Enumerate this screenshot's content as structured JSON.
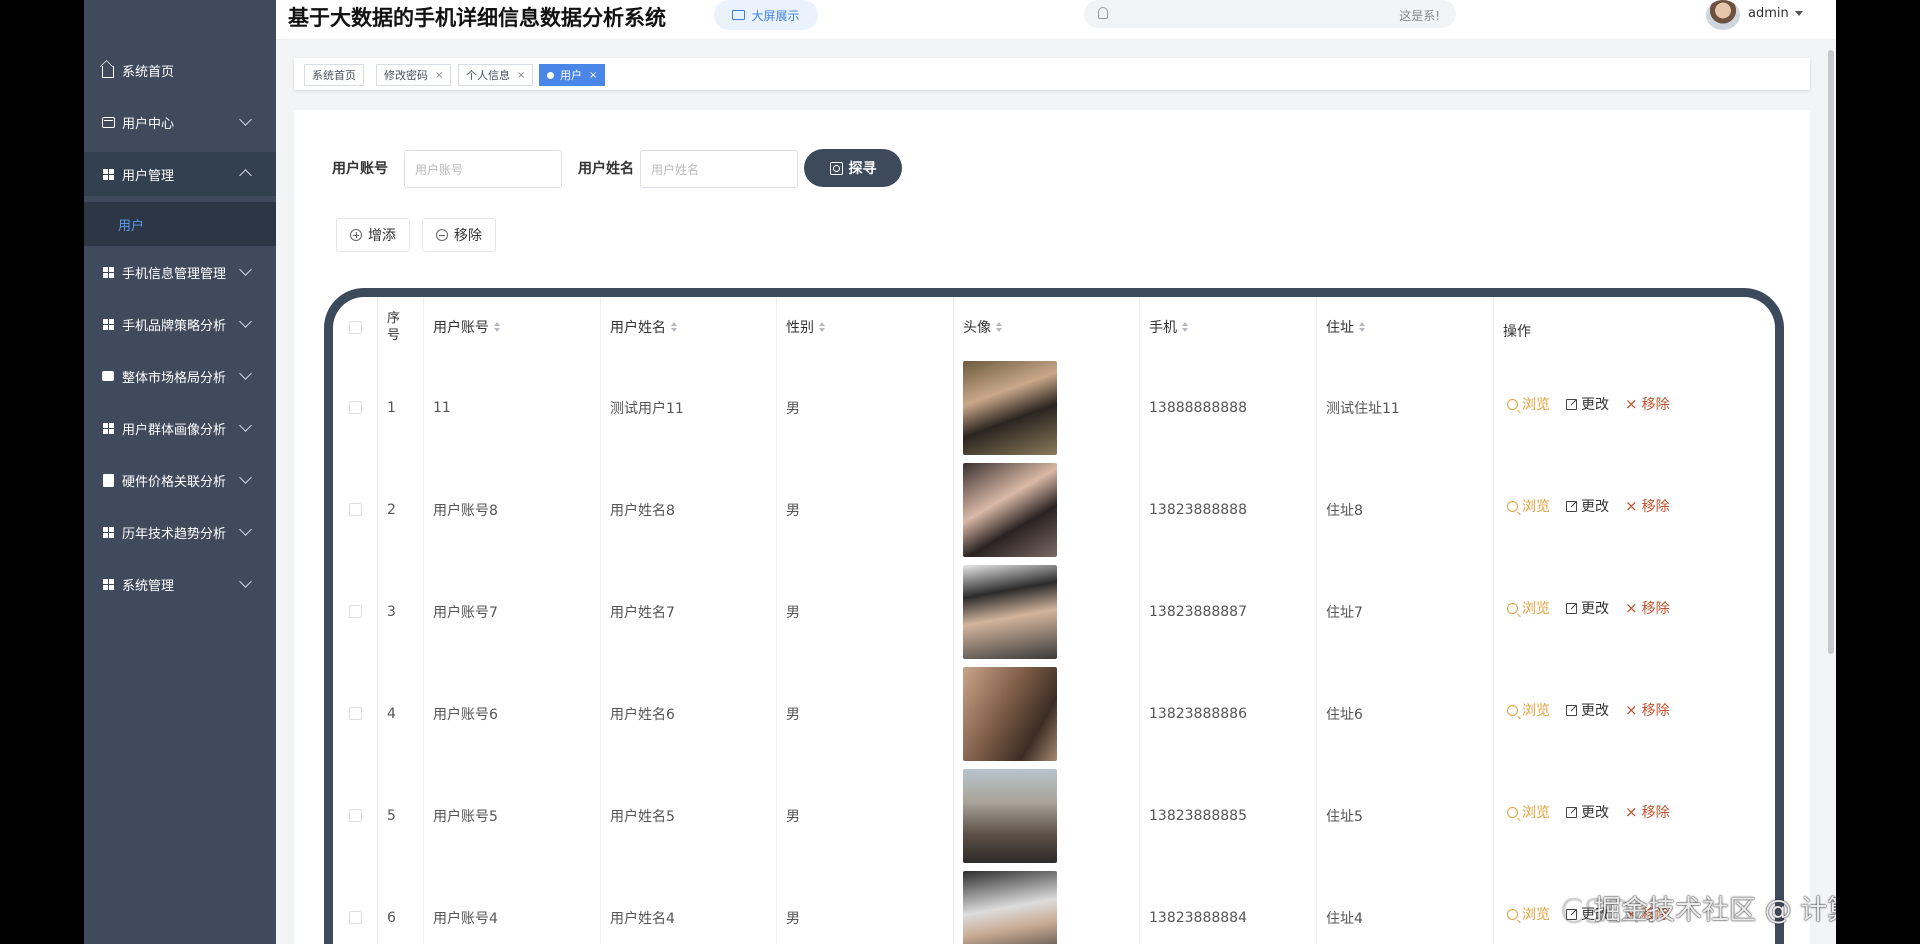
{
  "header": {
    "title": "基于大数据的手机详细信息数据分析系统",
    "big_screen_label": "大屏展示",
    "notice_text": "这是系!",
    "user_name": "admin"
  },
  "sidebar": {
    "items": [
      {
        "label": "系统首页",
        "icon": "home-icon"
      },
      {
        "label": "用户中心",
        "icon": "card-icon"
      },
      {
        "label": "用户管理",
        "icon": "grid-icon"
      },
      {
        "label": "手机信息管理管理",
        "icon": "grid-icon"
      },
      {
        "label": "手机品牌策略分析",
        "icon": "grid-icon"
      },
      {
        "label": "整体市场格局分析",
        "icon": "chat-icon"
      },
      {
        "label": "用户群体画像分析",
        "icon": "grid-icon"
      },
      {
        "label": "硬件价格关联分析",
        "icon": "clipboard-icon"
      },
      {
        "label": "历年技术趋势分析",
        "icon": "grid-icon"
      },
      {
        "label": "系统管理",
        "icon": "grid-icon"
      }
    ],
    "active_sub": "用户"
  },
  "tags": [
    {
      "label": "系统首页"
    },
    {
      "label": "修改密码"
    },
    {
      "label": "个人信息"
    },
    {
      "label": "用户"
    }
  ],
  "search": {
    "account_label": "用户账号",
    "account_placeholder": "用户账号",
    "name_label": "用户姓名",
    "name_placeholder": "用户姓名",
    "button_label": "探寻"
  },
  "actions": {
    "add": "增添",
    "remove": "移除"
  },
  "table": {
    "headers": [
      "序号",
      "用户账号",
      "用户姓名",
      "性别",
      "头像",
      "手机",
      "住址",
      "操作"
    ],
    "op_labels": {
      "view": "浏览",
      "edit": "更改",
      "delete": "移除"
    },
    "rows": [
      {
        "no": "1",
        "account": "11",
        "name": "测试用户11",
        "gender": "男",
        "phone": "13888888888",
        "address": "测试住址11"
      },
      {
        "no": "2",
        "account": "用户账号8",
        "name": "用户姓名8",
        "gender": "男",
        "phone": "13823888888",
        "address": "住址8"
      },
      {
        "no": "3",
        "account": "用户账号7",
        "name": "用户姓名7",
        "gender": "男",
        "phone": "13823888887",
        "address": "住址7"
      },
      {
        "no": "4",
        "account": "用户账号6",
        "name": "用户姓名6",
        "gender": "男",
        "phone": "13823888886",
        "address": "住址6"
      },
      {
        "no": "5",
        "account": "用户账号5",
        "name": "用户姓名5",
        "gender": "男",
        "phone": "13823888885",
        "address": "住址5"
      },
      {
        "no": "6",
        "account": "用户账号4",
        "name": "用户姓名4",
        "gender": "男",
        "phone": "13823888884",
        "address": "住址4"
      }
    ]
  },
  "watermark": "掘金技术社区 @ 计算机程序员小杨",
  "colors": {
    "sidebar": "#3f4a5c",
    "accent": "#4a86e8",
    "view": "#e6a23c",
    "delete": "#c0522d"
  }
}
